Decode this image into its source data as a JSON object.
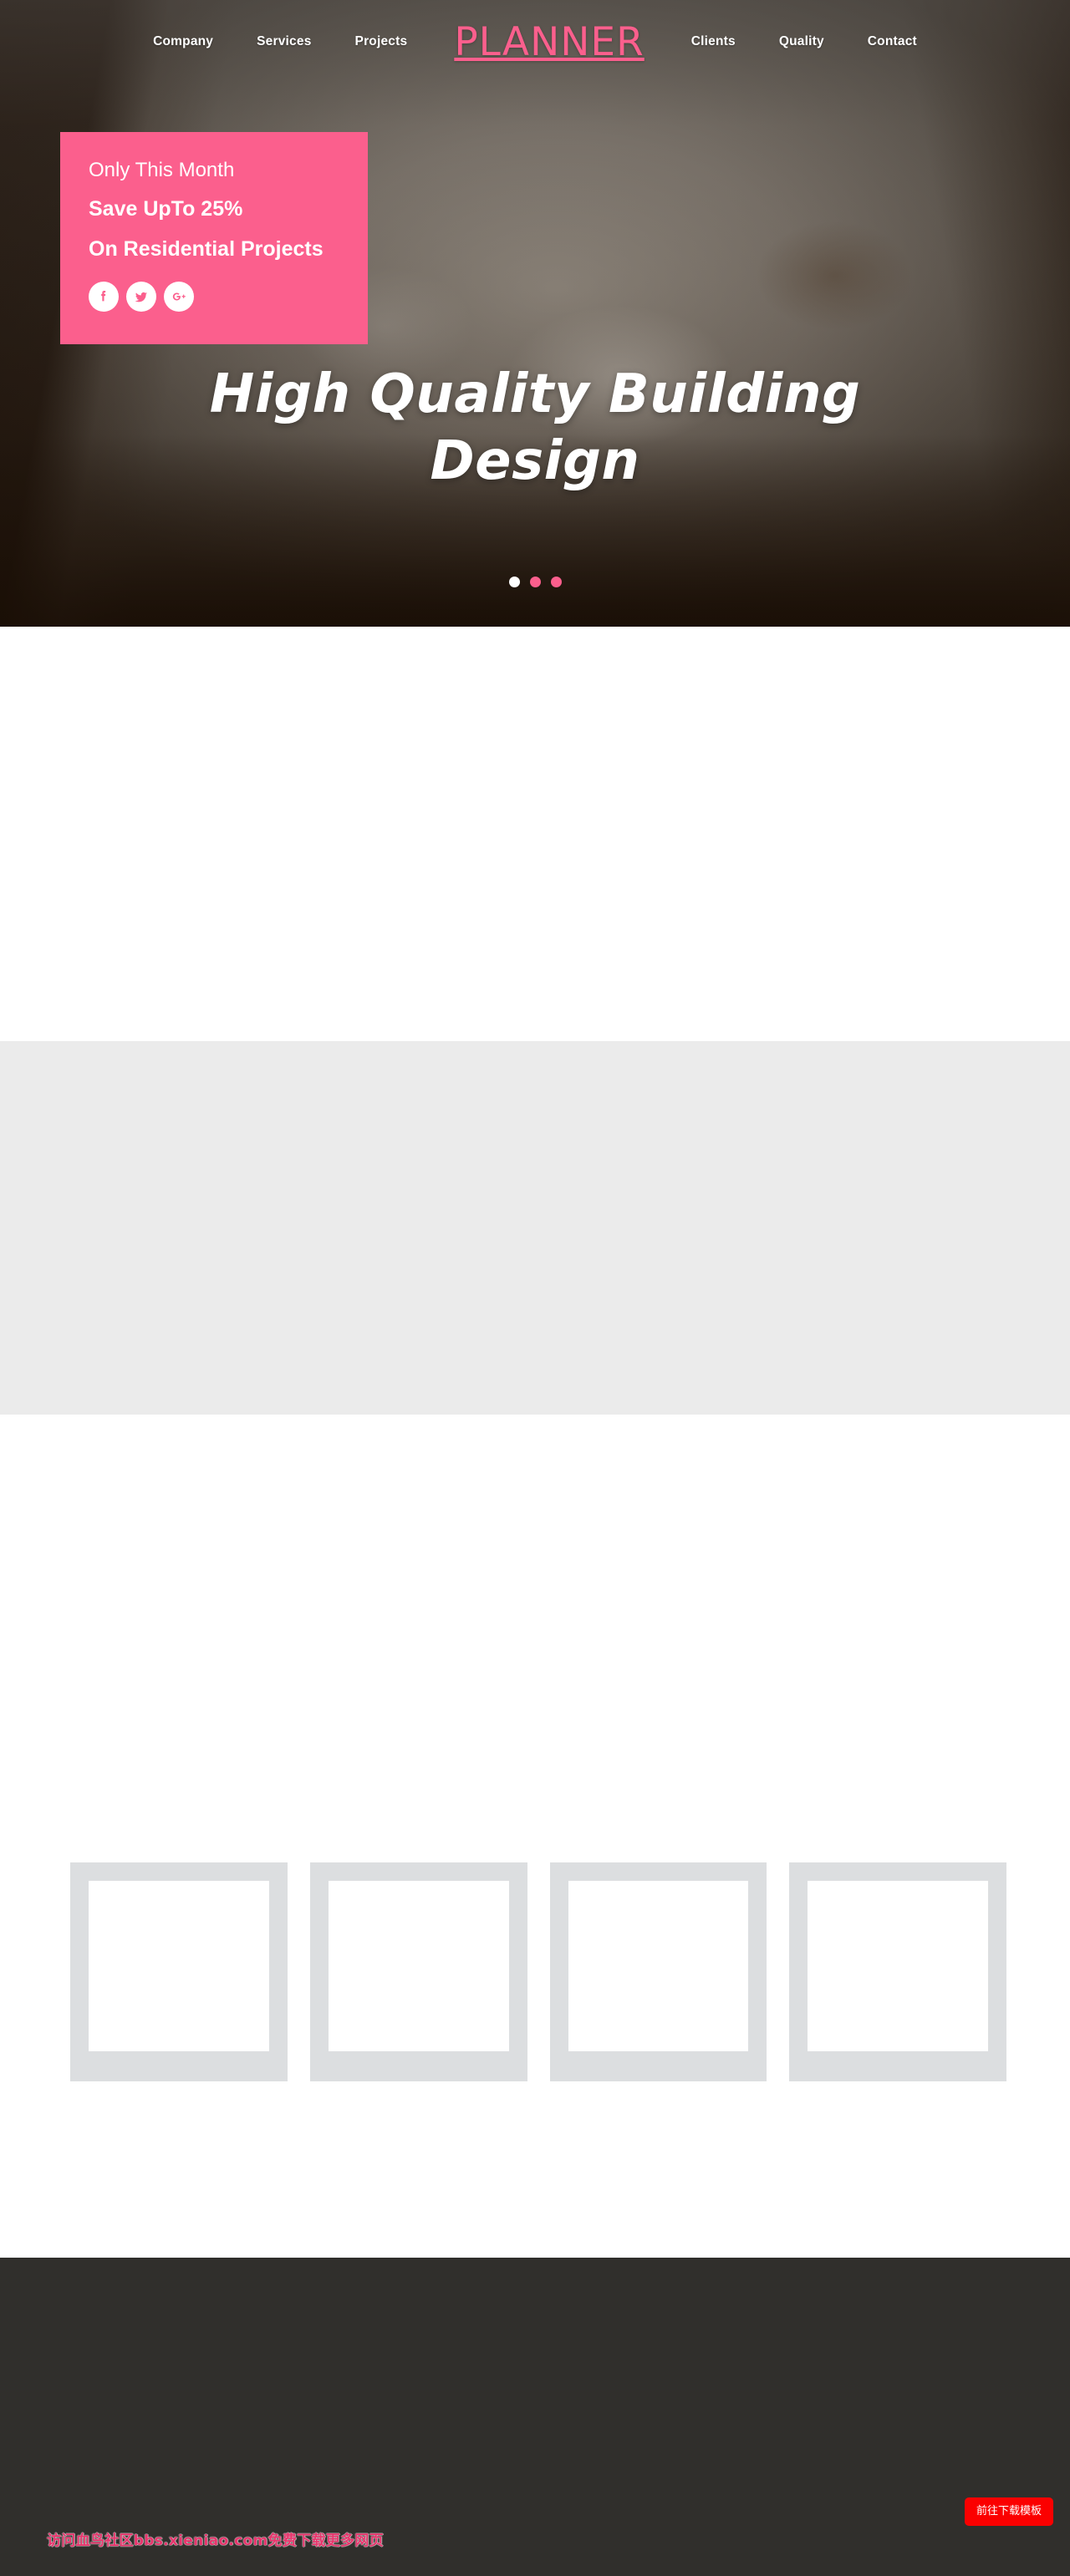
{
  "site": {
    "brand": "PLANNER"
  },
  "nav": {
    "left_items": [
      {
        "label": "Company",
        "name": "nav-company"
      },
      {
        "label": "Services",
        "name": "nav-services"
      },
      {
        "label": "Projects",
        "name": "nav-projects"
      }
    ],
    "right_items": [
      {
        "label": "Clients",
        "name": "nav-clients"
      },
      {
        "label": "Quality",
        "name": "nav-quality"
      },
      {
        "label": "Contact",
        "name": "nav-contact"
      }
    ]
  },
  "promo": {
    "line1": "Only This Month",
    "line2": "Save UpTo 25%",
    "line3": "On Residential Projects",
    "social": [
      {
        "name": "facebook-icon",
        "glyph": "f"
      },
      {
        "name": "twitter-icon",
        "glyph": "t"
      },
      {
        "name": "google-plus-icon",
        "glyph": "g+"
      }
    ]
  },
  "hero": {
    "title": "High Quality Building Design",
    "dots": [
      {
        "active": true
      },
      {
        "active": false
      },
      {
        "active": false
      }
    ]
  },
  "gallery": {
    "frames": [
      {
        "name": "image-placeholder-1"
      },
      {
        "name": "image-placeholder-2"
      },
      {
        "name": "image-placeholder-3"
      },
      {
        "name": "image-placeholder-4"
      }
    ]
  },
  "footer": {
    "watermark": "访问血鸟社区bbs.xieniao.com免费下载更多网页",
    "download_button": "前往下载模板"
  },
  "colors": {
    "accent_pink": "#fb5f8d",
    "footer_bg": "#302f2c",
    "section_gray": "#ebebeb",
    "frame_gray": "#dcdee0",
    "download_red": "#fb0000",
    "watermark_pink": "#e8356d"
  }
}
